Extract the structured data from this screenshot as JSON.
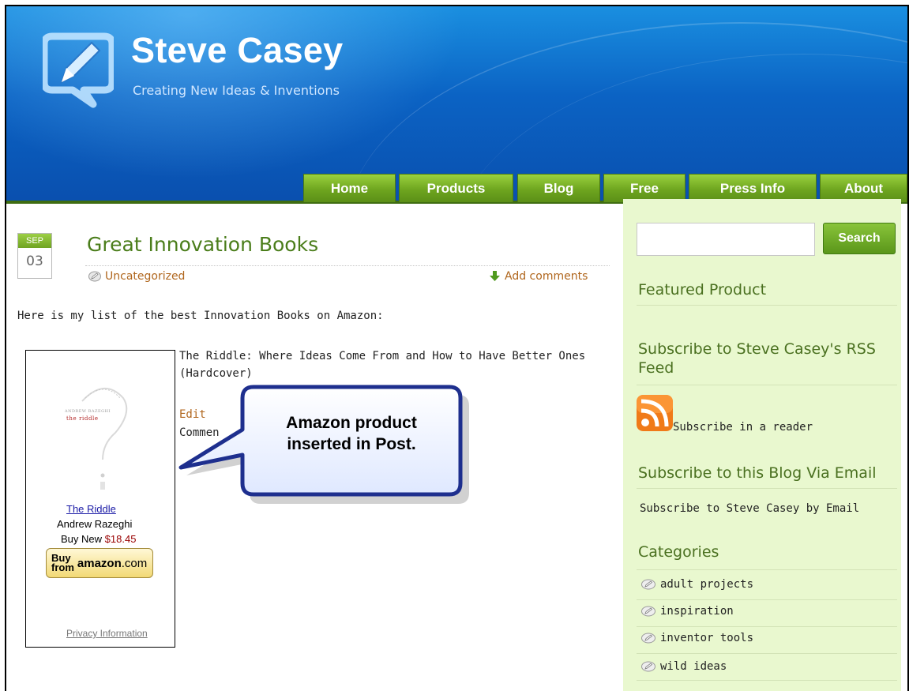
{
  "header": {
    "title": "Steve Casey",
    "tagline": "Creating New Ideas & Inventions",
    "logo_icon": "pencil-speech-bubble-icon"
  },
  "nav": {
    "items": [
      {
        "label": "Home"
      },
      {
        "label": "Products"
      },
      {
        "label": "Blog"
      },
      {
        "label": "Free"
      },
      {
        "label": "Press Info"
      },
      {
        "label": "About"
      }
    ]
  },
  "post": {
    "date_month": "SEP",
    "date_day": "03",
    "title": "Great Innovation Books",
    "category": "Uncategorized",
    "add_comments": "Add comments",
    "intro": "Here is my list of the best Innovation Books on Amazon:",
    "item_title": "The Riddle: Where Ideas Come From and How to Have Better Ones (Hardcover)",
    "edit": "Edit",
    "comment_partial": "Commen"
  },
  "amazon_widget": {
    "book_cover_title": "the riddle",
    "book_cover_author": "ANDREW RAZEGHI",
    "book_link": "The Riddle",
    "author": "Andrew Razeghi",
    "buy_new_label": "Buy New",
    "price": "$18.45",
    "buy_button_top": "Buy",
    "buy_button_bottom": "from",
    "buy_button_brand": "amazon",
    "buy_button_tld": ".com",
    "privacy": "Privacy Information"
  },
  "callout": {
    "line1": "Amazon product",
    "line2": "inserted in Post."
  },
  "sidebar": {
    "search_placeholder": "",
    "search_button": "Search",
    "featured_heading": "Featured Product",
    "rss_heading": "Subscribe to Steve Casey's RSS Feed",
    "rss_link": "Subscribe in a reader",
    "email_heading": "Subscribe to this Blog Via Email",
    "email_link": "Subscribe to Steve Casey by Email",
    "categories_heading": "Categories",
    "categories": [
      {
        "label": "adult projects"
      },
      {
        "label": "inspiration"
      },
      {
        "label": "inventor tools"
      },
      {
        "label": "wild ideas"
      }
    ]
  },
  "colors": {
    "header_blue": "#0b63c4",
    "nav_green": "#6ea51f",
    "title_green": "#4a7d1a",
    "link_orange": "#b0661d",
    "sidebar_bg": "#e9f8cf",
    "price_red": "#990000"
  }
}
